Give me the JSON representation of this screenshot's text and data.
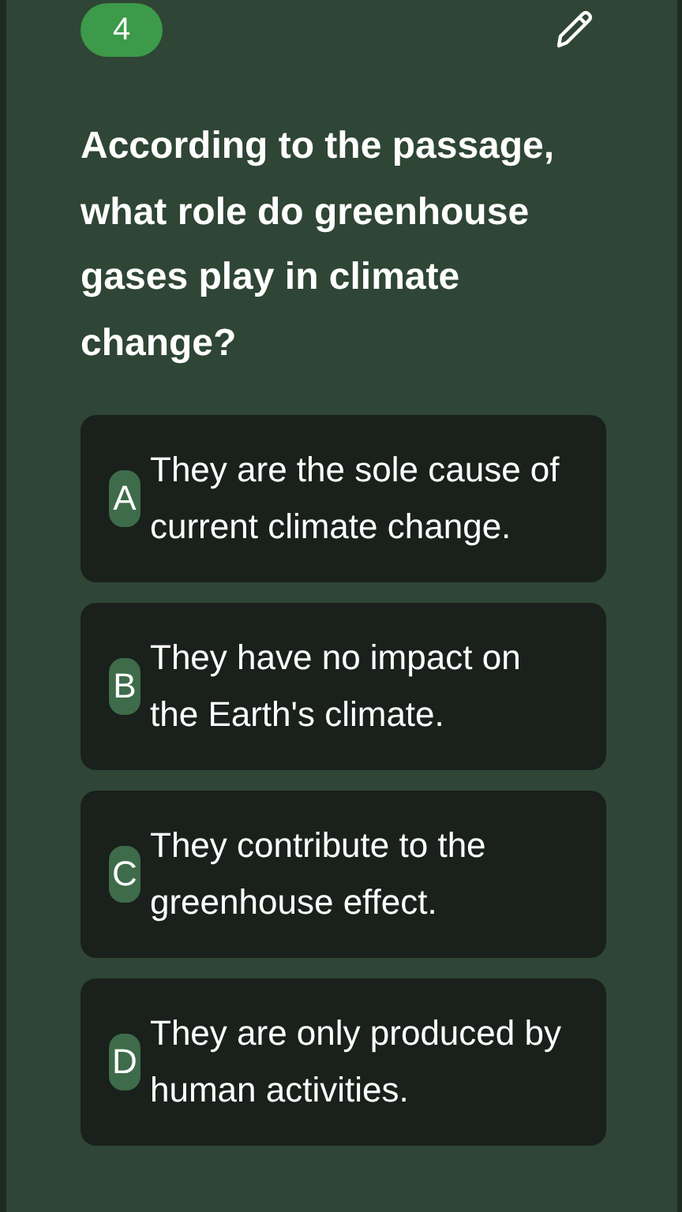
{
  "question_number": "4",
  "question": "According to the passage, what role do greenhouse gases play in climate change?",
  "options": [
    {
      "letter": "A",
      "text": "They are the sole cause of current climate change."
    },
    {
      "letter": "B",
      "text": "They have no impact on the Earth's climate."
    },
    {
      "letter": "C",
      "text": "They contribute to the greenhouse effect."
    },
    {
      "letter": "D",
      "text": "They are only produced by human activities."
    }
  ]
}
